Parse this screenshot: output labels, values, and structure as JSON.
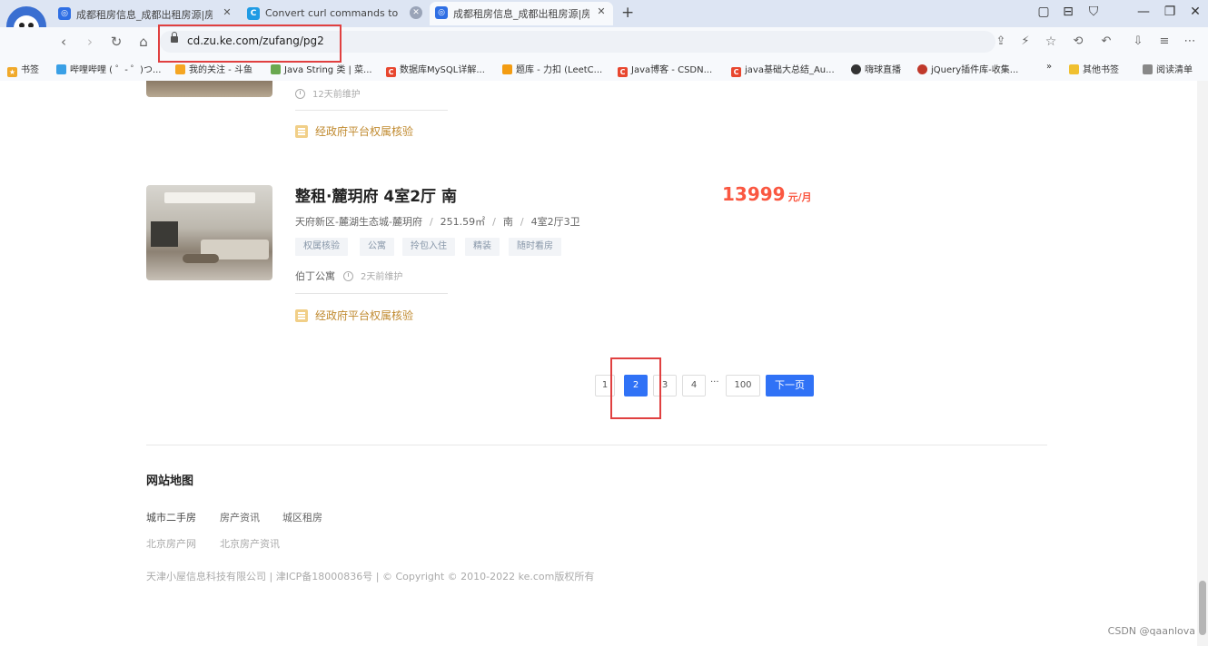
{
  "browser": {
    "tabs": [
      {
        "title": "成都租房信息_成都出租房源|房屋...",
        "favicon_color": "#2f6fe4",
        "active": false
      },
      {
        "title": "Convert curl commands to code",
        "favicon_color": "#1f9be4",
        "favicon_letter": "C",
        "active": false
      },
      {
        "title": "成都租房信息_成都出租房源|房屋...",
        "favicon_color": "#2f6fe4",
        "active": true
      }
    ],
    "new_tab": "+",
    "url": "cd.zu.ke.com/zufang/pg2",
    "bookmarks": [
      {
        "label": "书签",
        "color": "#f0a92a"
      },
      {
        "label": "哔哩哔哩 ( ゜- ゜)つ...",
        "color": "#3aa0e6"
      },
      {
        "label": "我的关注 - 斗鱼",
        "color": "#f5a623"
      },
      {
        "label": "Java String 类 | 菜...",
        "color": "#6aa84f"
      },
      {
        "label": "数据库MySQL详解...",
        "color": "#e8472f",
        "letter": "C"
      },
      {
        "label": "题库 - 力扣 (LeetC...",
        "color": "#f39c12"
      },
      {
        "label": "Java博客 - CSDN...",
        "color": "#e8472f",
        "letter": "C"
      },
      {
        "label": "java基础大总结_Au...",
        "color": "#e8472f",
        "letter": "C"
      },
      {
        "label": "嗨球直播",
        "color": "#333333"
      },
      {
        "label": "jQuery插件库-收集...",
        "color": "#c0392b"
      },
      {
        "label": "»",
        "color": "transparent"
      },
      {
        "label": "其他书签",
        "color": "#f0c030"
      },
      {
        "label": "阅读清单",
        "color": "#888888"
      }
    ]
  },
  "listing_prev": {
    "maintained": "12天前维护",
    "verify": "经政府平台权属核验"
  },
  "listing": {
    "title": "整租·麓玥府 4室2厅 南",
    "price": "13999",
    "price_unit": "元/月",
    "location": "天府新区-麓湖生态城-麓玥府",
    "area": "251.59㎡",
    "orientation": "南",
    "layout": "4室2厅3卫",
    "separator": "/",
    "tags": [
      "权属核验",
      "公寓",
      "拎包入住",
      "精装",
      "随时看房"
    ],
    "brand": "伯丁公寓",
    "maintained": "2天前维护",
    "verify": "经政府平台权属核验"
  },
  "pagination": {
    "pages": [
      "1",
      "2",
      "3",
      "4"
    ],
    "current": "2",
    "ellipsis": "···",
    "last": "100",
    "next": "下一页"
  },
  "footer": {
    "sitemap_title": "网站地图",
    "links_primary": [
      "城市二手房",
      "房产资讯",
      "城区租房"
    ],
    "links_secondary": [
      "北京房产网",
      "北京房产资讯"
    ],
    "copyright": "天津小屋信息科技有限公司 | 津ICP备18000836号 | © Copyright © 2010-2022 ke.com版权所有"
  },
  "watermark": "CSDN @qaanlova",
  "colors": {
    "accent": "#3072f6",
    "price": "#fa5741",
    "highlight_box": "#e04040",
    "verify": "#c08a2f"
  }
}
